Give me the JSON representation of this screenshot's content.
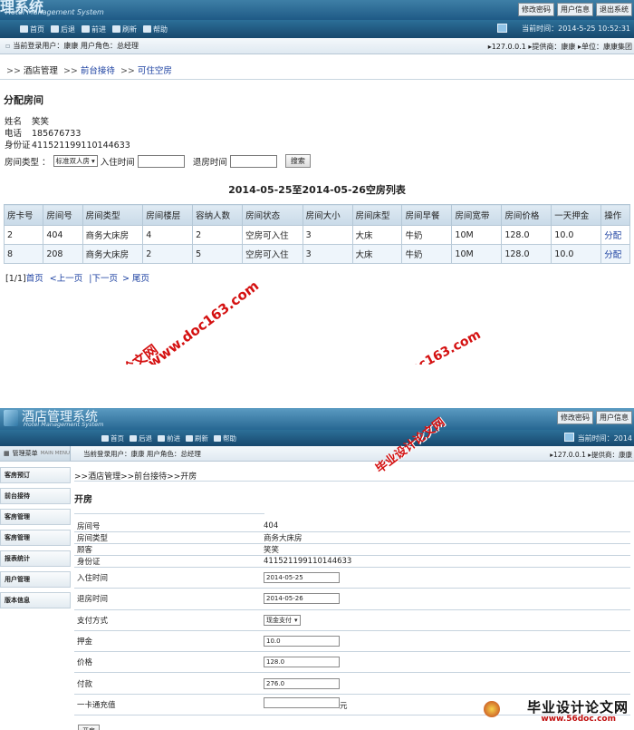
{
  "shot1": {
    "logo_cut": "理系统",
    "logo_sub": "Hotel Management System",
    "top_links": [
      "修改密码",
      "用户信息",
      "退出系统"
    ],
    "nav": [
      "首页",
      "后退",
      "前进",
      "刷新",
      "帮助"
    ],
    "current_time": "当前时间：2014-5-25 10:52:31",
    "user_info": "当前登录用户：康康  用户角色：总经理",
    "right_info": "▸127.0.0.1  ▸提供商：康康  ▸单位：康康集团",
    "crumb": [
      "酒店管理",
      "前台接待",
      "可住空房"
    ],
    "section_title": "分配房间",
    "guest": [
      {
        "label": "姓名",
        "value": "笑笑"
      },
      {
        "label": "电话",
        "value": "185676733"
      },
      {
        "label": "身份证",
        "value": "411521199110144633"
      }
    ],
    "filter": {
      "room_type_label": "房间类型 ：",
      "room_type_value": "标准双人房",
      "checkin_label": "入住时间",
      "checkout_label": "退房时间",
      "search_label": "搜索"
    },
    "list_title": "2014-05-25至2014-05-26空房列表",
    "columns": [
      "房卡号",
      "房间号",
      "房间类型",
      "房间楼层",
      "容纳人数",
      "房间状态",
      "房间大小",
      "房间床型",
      "房间早餐",
      "房间宽带",
      "房间价格",
      "一天押金",
      "操作"
    ],
    "rows": [
      [
        "2",
        "404",
        "商务大床房",
        "4",
        "2",
        "空房可入住",
        "3",
        "大床",
        "牛奶",
        "10M",
        "128.0",
        "10.0",
        "分配"
      ],
      [
        "8",
        "208",
        "商务大床房",
        "2",
        "5",
        "空房可入住",
        "3",
        "大床",
        "牛奶",
        "10M",
        "128.0",
        "10.0",
        "分配"
      ]
    ],
    "pager": {
      "count": "[1/1]",
      "first": "首页",
      "prev": "<上一页",
      "next": "|下一页",
      "last": "> 尾页"
    }
  },
  "watermarks": {
    "line1": "毕业设计论文网",
    "line2": "www.doc163.com"
  },
  "shot2": {
    "title": "酒店管理系统",
    "sub": "Hotel Management System",
    "top_links": [
      "修改密码",
      "用户信息"
    ],
    "nav": [
      "首页",
      "后退",
      "前进",
      "刷新",
      "帮助"
    ],
    "current_time": "当前时间：2014",
    "menu_head": "管理菜单",
    "menu_head_en": "MAIN MENU",
    "user_info": "当前登录用户：康康  用户角色：总经理",
    "right_info": "▸127.0.0.1  ▸提供商：康康",
    "left_menu": [
      "客房预订",
      "前台接待",
      "客房管理",
      "客房管理",
      "报表统计",
      "用户管理",
      "版本信息"
    ],
    "crumb": ">>酒店管理>>前台接待>>开房",
    "section_title": "开房",
    "fields": [
      {
        "label": "房间号",
        "value": "404",
        "kind": "text"
      },
      {
        "label": "房间类型",
        "value": "商务大床房",
        "kind": "text"
      },
      {
        "label": "顾客",
        "value": "笑笑",
        "kind": "text"
      },
      {
        "label": "身份证",
        "value": "411521199110144633",
        "kind": "text"
      },
      {
        "label": "入住时间",
        "value": "2014-05-25",
        "kind": "input"
      },
      {
        "label": "退房时间",
        "value": "2014-05-26",
        "kind": "input"
      },
      {
        "label": "支付方式",
        "value": "现金支付",
        "kind": "select"
      },
      {
        "label": "押金",
        "value": "10.0",
        "kind": "input"
      },
      {
        "label": "价格",
        "value": "128.0",
        "kind": "input"
      },
      {
        "label": "付款",
        "value": "276.0",
        "kind": "input"
      },
      {
        "label": "一卡通充值",
        "value": "",
        "kind": "input",
        "suffix": "元"
      }
    ],
    "submit_label": "开房",
    "foot_logo": "毕业设计论文网",
    "foot_url": "www.56doc.com"
  }
}
